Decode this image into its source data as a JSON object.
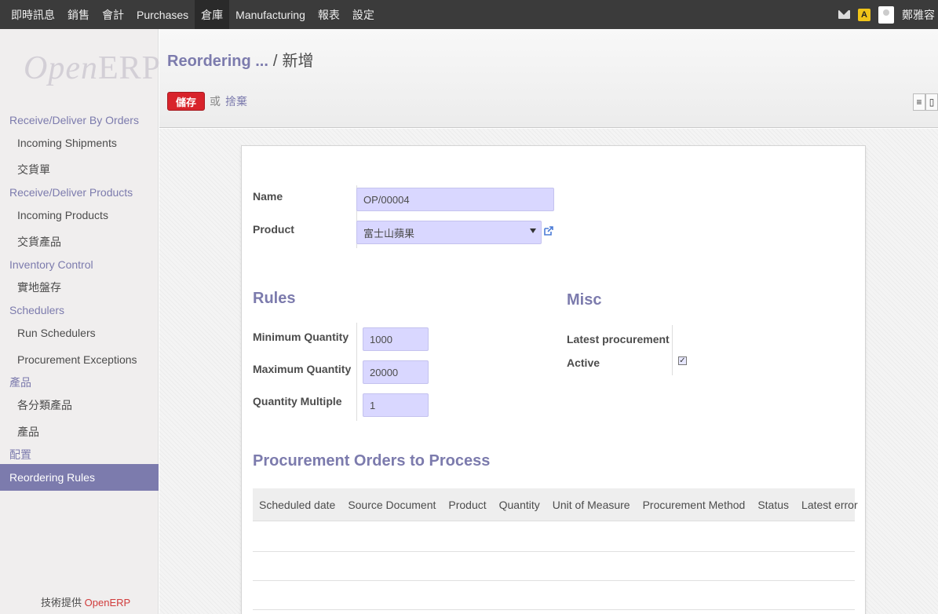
{
  "topbar": {
    "menu": [
      "即時訊息",
      "銷售",
      "會計",
      "Purchases",
      "倉庫",
      "Manufacturing",
      "報表",
      "設定"
    ],
    "active_index": 4,
    "icons": [
      "mail-icon",
      "alert-icon",
      "avatar"
    ],
    "alert_badge": "A",
    "user": "鄭雅容"
  },
  "sidebar": {
    "logo_open": "Open",
    "logo_erp": "ERP",
    "sections": [
      {
        "title": "Receive/Deliver By Orders",
        "items": [
          "Incoming Shipments",
          "交貨單"
        ]
      },
      {
        "title": "Receive/Deliver Products",
        "items": [
          "Incoming Products",
          "交貨產品"
        ]
      },
      {
        "title": "Inventory Control",
        "items": [
          "實地盤存"
        ]
      },
      {
        "title": "Schedulers",
        "items": [
          "Run Schedulers",
          "Procurement Exceptions"
        ]
      },
      {
        "title": "產品",
        "items": [
          "各分類產品",
          "產品"
        ]
      },
      {
        "title": "配置",
        "items": [
          "Reordering Rules"
        ]
      }
    ],
    "active_item": "Reordering Rules",
    "powered_prefix": "技術提供",
    "powered_brand": "OpenERP"
  },
  "header": {
    "breadcrumb_link": "Reordering ...",
    "breadcrumb_sep": "/",
    "breadcrumb_current": "新增",
    "save_label": "儲存",
    "or_label": "或",
    "discard_label": "捨棄"
  },
  "form": {
    "name_label": "Name",
    "name_value": "OP/00004",
    "product_label": "Product",
    "product_value": "富士山蘋果",
    "rules_title": "Rules",
    "min_qty_label": "Minimum Quantity",
    "min_qty_value": "1000",
    "max_qty_label": "Maximum Quantity",
    "max_qty_value": "20000",
    "qty_multiple_label": "Quantity Multiple",
    "qty_multiple_value": "1",
    "misc_title": "Misc",
    "latest_procurement_label": "Latest procurement",
    "active_label": "Active",
    "active_checked": true,
    "checkbox_mark": "✓",
    "procurement_title": "Procurement Orders to Process",
    "columns": [
      "Scheduled date",
      "Source Document",
      "Product",
      "Quantity",
      "Unit of Measure",
      "Procurement Method",
      "Status",
      "Latest error"
    ]
  },
  "colors": {
    "accent": "#7c7bad",
    "save": "#d8232b",
    "field_bg": "#d9d7ff",
    "topbar": "#3b3b3b"
  }
}
